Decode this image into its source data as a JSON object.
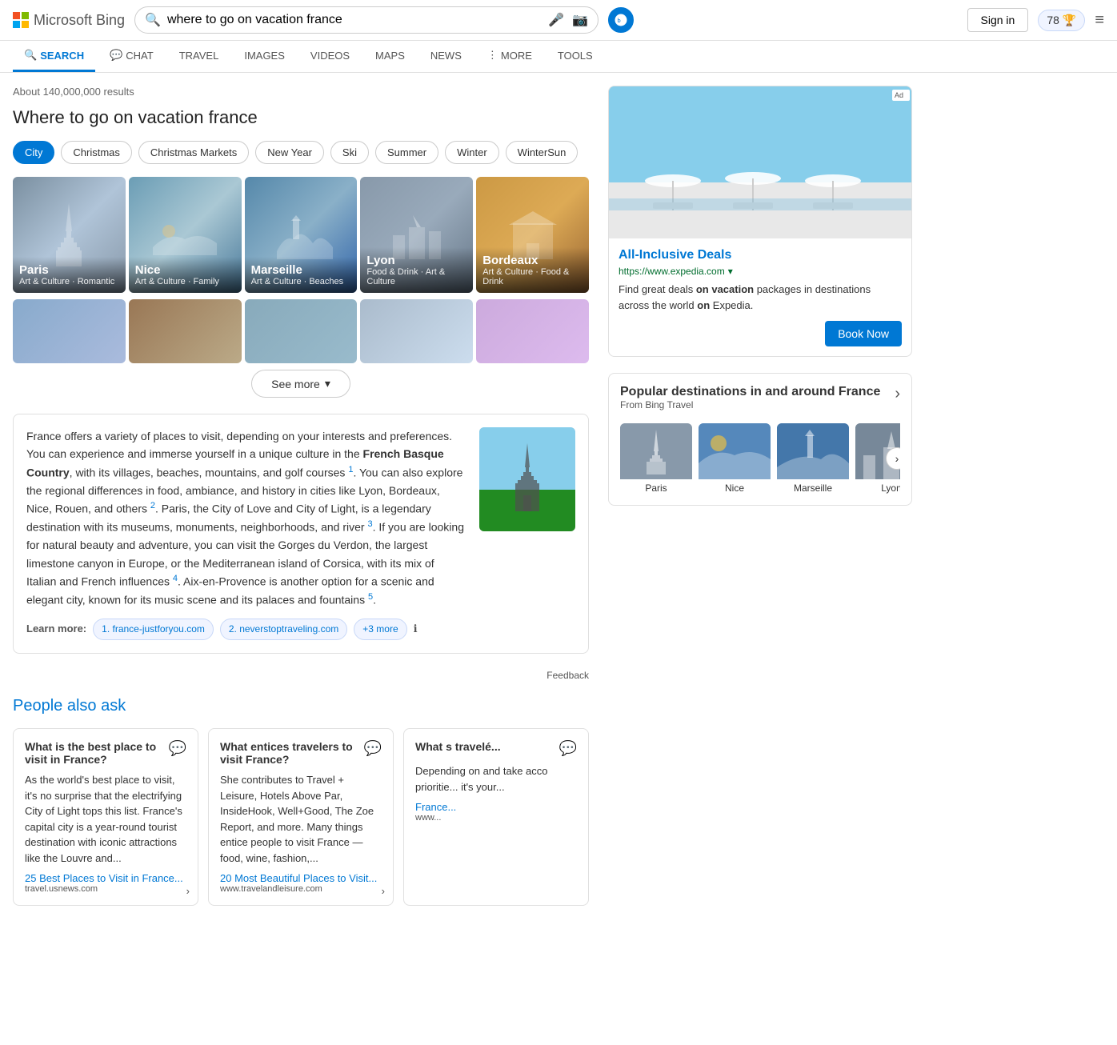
{
  "header": {
    "logo_text": "Microsoft Bing",
    "search_query": "where to go on vacation france",
    "sign_in_label": "Sign in",
    "points": "78"
  },
  "nav": {
    "items": [
      {
        "id": "search",
        "label": "SEARCH",
        "active": true,
        "icon": "🔍"
      },
      {
        "id": "chat",
        "label": "CHAT",
        "active": false,
        "icon": "💬"
      },
      {
        "id": "travel",
        "label": "TRAVEL",
        "active": false,
        "icon": ""
      },
      {
        "id": "images",
        "label": "IMAGES",
        "active": false,
        "icon": ""
      },
      {
        "id": "videos",
        "label": "VIDEOS",
        "active": false,
        "icon": ""
      },
      {
        "id": "maps",
        "label": "MAPS",
        "active": false,
        "icon": ""
      },
      {
        "id": "news",
        "label": "NEWS",
        "active": false,
        "icon": ""
      },
      {
        "id": "more",
        "label": "MORE",
        "active": false,
        "icon": ""
      },
      {
        "id": "tools",
        "label": "TOOLS",
        "active": false,
        "icon": ""
      }
    ]
  },
  "results": {
    "count": "About 140,000,000 results",
    "title": "Where to go on vacation france",
    "filters": [
      {
        "id": "city",
        "label": "City",
        "active": true
      },
      {
        "id": "christmas",
        "label": "Christmas",
        "active": false
      },
      {
        "id": "christmas-markets",
        "label": "Christmas Markets",
        "active": false
      },
      {
        "id": "new-year",
        "label": "New Year",
        "active": false
      },
      {
        "id": "ski",
        "label": "Ski",
        "active": false
      },
      {
        "id": "summer",
        "label": "Summer",
        "active": false
      },
      {
        "id": "winter",
        "label": "Winter",
        "active": false
      },
      {
        "id": "wintersun",
        "label": "WinterSun",
        "active": false
      }
    ],
    "cities_row1": [
      {
        "name": "Paris",
        "tags": "Art & Culture · Romantic",
        "color": "paris"
      },
      {
        "name": "Nice",
        "tags": "Art & Culture · Family",
        "color": "nice"
      },
      {
        "name": "Marseille",
        "tags": "Art & Culture · Beaches",
        "color": "marseille"
      },
      {
        "name": "Lyon",
        "tags": "Food & Drink · Art & Culture",
        "color": "lyon"
      },
      {
        "name": "Bordeaux",
        "tags": "Art & Culture · Food & Drink",
        "color": "bordeaux"
      }
    ],
    "see_more_label": "See more",
    "description": {
      "text_parts": [
        "France offers a variety of places to visit, depending on your interests and preferences. You can experience and immerse yourself in a unique culture in the ",
        "French Basque Country",
        ", with its villages, beaches, mountains, and golf courses",
        ". You can also explore the regional differences in food, ambiance, and history in cities like Lyon, Bordeaux, Nice, Rouen, and others",
        ". Paris, the City of Love and City of Light, is a legendary destination with its museums, monuments, neighborhoods, and river",
        ". If you are looking for natural beauty and adventure, you can visit the Gorges du Verdon, the largest limestone canyon in Europe, or the Mediterranean island of Corsica, with its mix of Italian and French influences",
        ". Aix-en-Provence is another option for a scenic and elegant city, known for its music scene and its palaces and fountains",
        "."
      ],
      "learn_more_label": "Learn more:",
      "sources": [
        {
          "id": "s1",
          "label": "1. france-justforyou.com"
        },
        {
          "id": "s2",
          "label": "2. neverstoptraveling.com"
        },
        {
          "id": "s3",
          "label": "+3 more"
        }
      ],
      "feedback_label": "Feedback"
    },
    "paa": {
      "title": "People also ask",
      "cards": [
        {
          "question": "What is the best place to visit in France?",
          "text": "As the world's best place to visit, it's no surprise that the electrifying City of Light tops this list. France's capital city is a year-round tourist destination with iconic attractions like the Louvre and...",
          "link_label": "25 Best Places to Visit in France...",
          "link_url": "travel.usnews.com/rankings/best-...",
          "link_source": "travel.usnews.com"
        },
        {
          "question": "What entices travelers to visit France?",
          "text": "She contributes to Travel + Leisure, Hotels Above Par, InsideHook, Well+Good, The Zoe Report, and more. Many things entice people to visit France — food, wine, fashion,...",
          "link_label": "20 Most Beautiful Places to Visit...",
          "link_url": "www.travelandleisure.com/best-p...",
          "link_source": "www.travelandleisure.com"
        },
        {
          "question": "What s travelé...",
          "text": "Depending on and take acco prioritie... it's your...",
          "link_label": "France...",
          "link_url": "www...",
          "link_source": "www..."
        }
      ]
    }
  },
  "sidebar": {
    "ad": {
      "badge": "Ad",
      "title": "All-Inclusive Deals",
      "url": "https://www.expedia.com",
      "description": "Find great deals on vacation packages in destinations across the world on Expedia.",
      "book_label": "Book Now"
    },
    "popular": {
      "title": "Popular destinations in and around France",
      "subtitle": "From Bing Travel",
      "destinations": [
        {
          "name": "Paris",
          "color": "dest-paris"
        },
        {
          "name": "Nice",
          "color": "dest-nice"
        },
        {
          "name": "Marseille",
          "color": "dest-marseille"
        },
        {
          "name": "Lyon",
          "color": "dest-lyon"
        }
      ]
    }
  },
  "icons": {
    "search": "🔍",
    "mic": "🎤",
    "camera": "📷",
    "chevron_down": "▾",
    "arrow_right": "›",
    "bubble": "💬",
    "info": "ℹ",
    "ellipsis": "⋮"
  }
}
